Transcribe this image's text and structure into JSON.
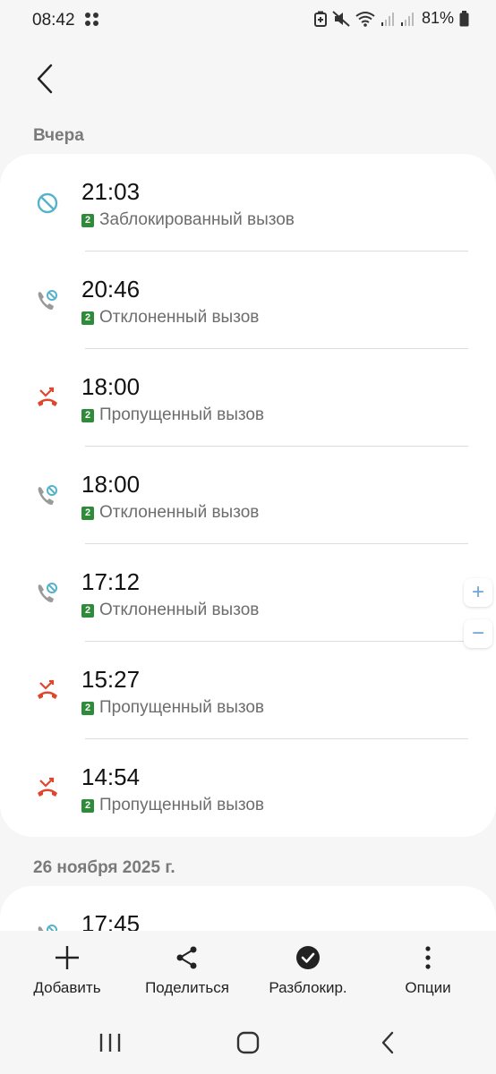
{
  "status": {
    "time": "08:42",
    "battery": "81%"
  },
  "sections": [
    {
      "header": "Вчера",
      "calls": [
        {
          "time": "21:03",
          "sim": "2",
          "type": "Заблокированный вызов",
          "icon": "blocked-icon"
        },
        {
          "time": "20:46",
          "sim": "2",
          "type": "Отклоненный вызов",
          "icon": "rejected-call-icon"
        },
        {
          "time": "18:00",
          "sim": "2",
          "type": "Пропущенный вызов",
          "icon": "missed-call-icon"
        },
        {
          "time": "18:00",
          "sim": "2",
          "type": "Отклоненный вызов",
          "icon": "rejected-call-icon"
        },
        {
          "time": "17:12",
          "sim": "2",
          "type": "Отклоненный вызов",
          "icon": "rejected-call-icon"
        },
        {
          "time": "15:27",
          "sim": "2",
          "type": "Пропущенный вызов",
          "icon": "missed-call-icon"
        },
        {
          "time": "14:54",
          "sim": "2",
          "type": "Пропущенный вызов",
          "icon": "missed-call-icon"
        }
      ]
    },
    {
      "header": "26 ноября 2025 г.",
      "calls": [
        {
          "time": "17:45",
          "icon": "rejected-call-icon"
        }
      ]
    }
  ],
  "zoom": {
    "plus": "+",
    "minus": "−"
  },
  "toolbar": {
    "add": "Добавить",
    "share": "Поделиться",
    "unblock": "Разблокир.",
    "options": "Опции"
  },
  "colors": {
    "missed": "#e0452d",
    "rejected_phone": "#9a9a9a",
    "blocked": "#55b3c9",
    "sim": "#2e8b3a"
  }
}
